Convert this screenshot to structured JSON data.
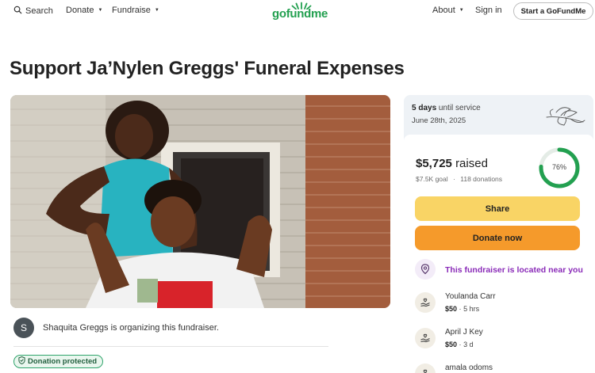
{
  "nav": {
    "search_label": "Search",
    "donate_label": "Donate",
    "fundraise_label": "Fundraise",
    "logo_text": "gofundme",
    "about_label": "About",
    "signin_label": "Sign in",
    "start_label": "Start a GoFundMe"
  },
  "campaign": {
    "title": "Support Ja’Nylen Greggs' Funeral Expenses",
    "organizer_initial": "S",
    "organizer_text": "Shaquita Greggs is organizing this fundraiser.",
    "protected_label": "Donation protected"
  },
  "sidebar": {
    "days_value": "5 days",
    "days_suffix": "until service",
    "service_date": "June 28th, 2025",
    "raised_amount": "$5,725",
    "raised_label": "raised",
    "goal_label": "$7.5K goal",
    "separator": "·",
    "donations_label": "118 donations",
    "progress_percent": 76,
    "progress_text": "76%",
    "share_label": "Share",
    "donate_label": "Donate now",
    "near_label": "This fundraiser is located near you",
    "donors": [
      {
        "name": "Youlanda Carr",
        "amount": "$50",
        "time": "5 hrs"
      },
      {
        "name": "April J Key",
        "amount": "$50",
        "time": "3 d"
      },
      {
        "name": "amala odoms",
        "amount": "",
        "time": ""
      }
    ]
  },
  "colors": {
    "brand_green": "#23a050",
    "share_yellow": "#f9d465",
    "donate_orange": "#f59a2b",
    "near_purple": "#8a2bb8"
  }
}
